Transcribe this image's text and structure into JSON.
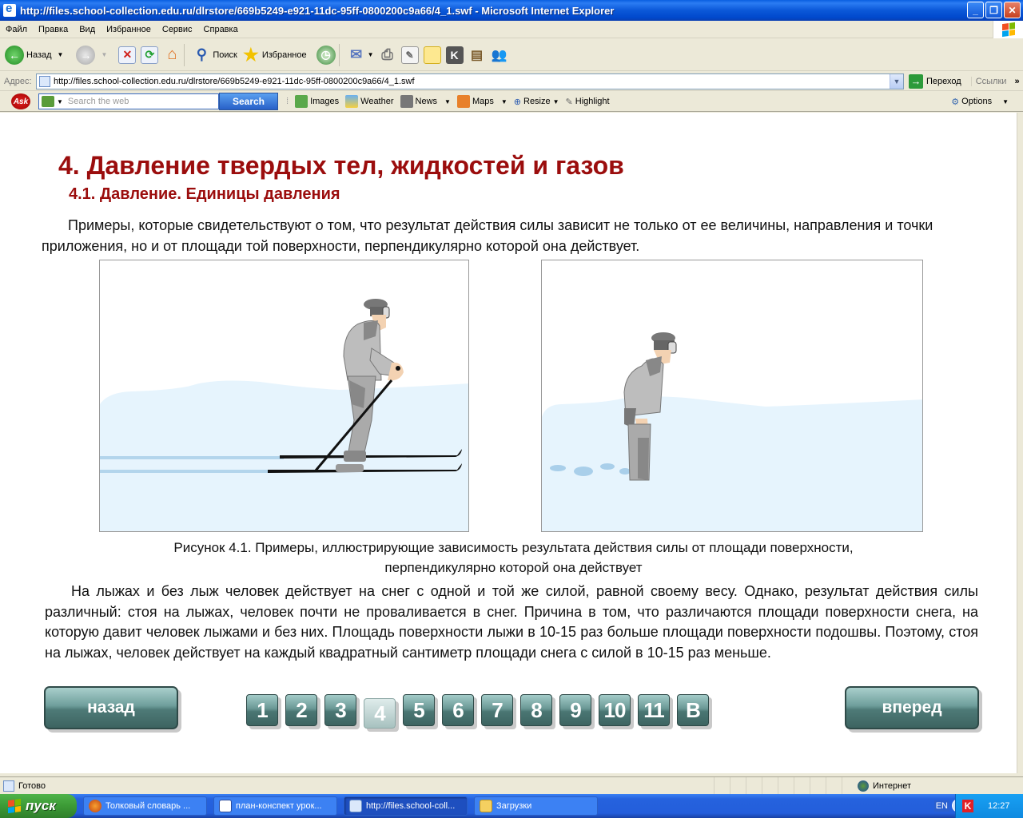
{
  "window": {
    "title": "http://files.school-collection.edu.ru/dlrstore/669b5249-e921-11dc-95ff-0800200c9a66/4_1.swf - Microsoft Internet Explorer",
    "minimize": "_",
    "restore": "❐",
    "close": "✕"
  },
  "menu": [
    "Файл",
    "Правка",
    "Вид",
    "Избранное",
    "Сервис",
    "Справка"
  ],
  "toolbar": {
    "back": "Назад",
    "search": "Поиск",
    "favorites": "Избранное"
  },
  "address": {
    "label": "Адрес:",
    "url": "http://files.school-collection.edu.ru/dlrstore/669b5249-e921-11dc-95ff-0800200c9a66/4_1.swf",
    "go": "Переход",
    "links": "Ссылки",
    "more": "»"
  },
  "askbar": {
    "logo": "Ask",
    "placeholder": "Search the web",
    "search_button": "Search",
    "items": [
      "Images",
      "Weather",
      "News",
      "Maps",
      "Resize",
      "Highlight"
    ],
    "options": "Options"
  },
  "page": {
    "heading": "4. Давление твердых тел, жидкостей и газов",
    "subheading": "4.1. Давление. Единицы давления",
    "intro": "Примеры, которые свидетельствуют о том, что результат действия силы зависит не только от ее величины, направления и точки приложения, но и от площади той поверхности, перпендикулярно которой она действует.",
    "figure_caption_line1": "Рисунок 4.1. Примеры, иллюстрирующие зависимость результата действия силы от площади поверхности,",
    "figure_caption_line2": "перпендикулярно которой она действует",
    "body": "На лыжах и без лыж человек действует на снег с одной и той же силой, равной своему весу. Однако, результат действия силы различный: стоя на лыжах, человек почти не проваливается в снег. Причина в том, что различаются площади поверхности снега, на которую давит человек лыжами и без них. Площадь поверхности лыжи в 10-15 раз больше площади поверхности подошвы. Поэтому, стоя на лыжах, человек действует на каждый квадратный сантиметр площади снега с силой в 10-15 раз меньше.",
    "nav": {
      "back": "назад",
      "forward": "вперед",
      "pages": [
        "1",
        "2",
        "3",
        "4",
        "5",
        "6",
        "7",
        "8",
        "9",
        "10",
        "11",
        "В"
      ],
      "current_page": "4"
    }
  },
  "status": {
    "text": "Готово",
    "zone": "Интернет"
  },
  "taskbar": {
    "start": "пуск",
    "tasks": [
      {
        "label": "Толковый словарь ...",
        "active": false
      },
      {
        "label": "план-конспект урок...",
        "active": false
      },
      {
        "label": "http://files.school-coll...",
        "active": true
      },
      {
        "label": "Загрузки",
        "active": false
      }
    ],
    "language": "EN",
    "clock": "12:27"
  },
  "colors": {
    "heading": "#9b0d0d",
    "snow": "#e6f4fd",
    "nav_button": "#4e7a77"
  }
}
